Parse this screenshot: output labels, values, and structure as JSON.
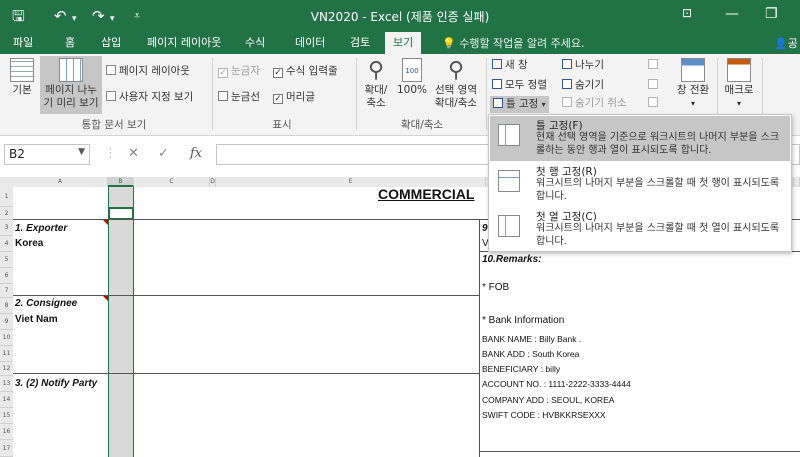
{
  "window": {
    "title": "VN2020 - Excel (제품 인증 실패)"
  },
  "tabs": [
    {
      "label": "파일"
    },
    {
      "label": "홈"
    },
    {
      "label": "삽입"
    },
    {
      "label": "페이지 레이아웃"
    },
    {
      "label": "수식"
    },
    {
      "label": "데이터"
    },
    {
      "label": "검토"
    },
    {
      "label": "보기"
    }
  ],
  "tell_me": "수행할 작업을 알려 주세요.",
  "account": "공",
  "ribbon": {
    "workbook_views": {
      "normal": "기본",
      "page_break": [
        "페이지 나누",
        "기 미리 보기"
      ],
      "page_layout": "페이지 레이아웃",
      "custom_views": "사용자 지정 보기",
      "group_label": "통합 문서 보기"
    },
    "show": {
      "ruler": "눈금자",
      "formula_bar": "수식 입력줄",
      "gridlines": "눈금선",
      "headings": "머리글",
      "group_label": "표시"
    },
    "zoom": {
      "zoom": [
        "확대/",
        "축소"
      ],
      "zoom100": "100%",
      "zoom_selection": [
        "선택 영역",
        "확대/축소"
      ],
      "group_label": "확대/축소"
    },
    "window": {
      "new_window": "새 창",
      "arrange_all": "모두 정렬",
      "freeze_panes": "틀 고정",
      "split": "나누기",
      "hide": "숨기기",
      "unhide": "숨기기 취소",
      "switch_windows": [
        "창 전환"
      ],
      "macros": "매크로"
    }
  },
  "formula_bar": {
    "name_box": "B2",
    "cancel": "✕",
    "enter": "✓",
    "fx": "fx",
    "value": ""
  },
  "sheet": {
    "col_headers": [
      "A",
      "B",
      "C",
      "D",
      "E"
    ],
    "row_headers": [
      "1",
      "2",
      "3",
      "4",
      "5",
      "6",
      "7",
      "8",
      "9",
      "10",
      "11",
      "12",
      "13",
      "14",
      "15",
      "16",
      "17"
    ],
    "title": "COMMERCIAL",
    "cells": {
      "exporter_label": "1. Exporter",
      "exporter_value": "Korea",
      "consignee_label": "2. Consignee",
      "consignee_value": "Viet Nam",
      "notify_label": "3. (2) Notify Party",
      "field9_label": "9",
      "field9_value": "V",
      "remarks_label": "10.Remarks:",
      "fob": "* FOB",
      "bank_info": "* Bank Information",
      "bank_name": "BANK NAME : Billy Bank .",
      "bank_add": "BANK ADD : South Korea",
      "beneficiary": "BENEFICIARY : billy",
      "account_no": "ACCOUNT NO. : 1111-2222-3333-4444",
      "company_add": "COMPANY ADD :  SEOUL, KOREA",
      "swift": "SWIFT CODE : HVBKKRSEXXX"
    }
  },
  "freeze_menu": {
    "items": [
      {
        "title": "틀 고정(F)",
        "desc": "현재 선택 영역을 기준으로 워크시트의 나머지 부분을 스크롤하는 동안 행과 열이 표시되도록 합니다."
      },
      {
        "title": "첫 행 고정(R)",
        "desc": "워크시트의 나머지 부분을 스크롤할 때 첫 행이 표시되도록 합니다."
      },
      {
        "title": "첫 열 고정(C)",
        "desc": "워크시트의 나머지 부분을 스크롤할 때 첫 열이 표시되도록 합니다."
      }
    ]
  },
  "colors": {
    "accent": "#217346",
    "ribbon_bg": "#f3f3f3",
    "highlight": "#c6c6c6"
  }
}
